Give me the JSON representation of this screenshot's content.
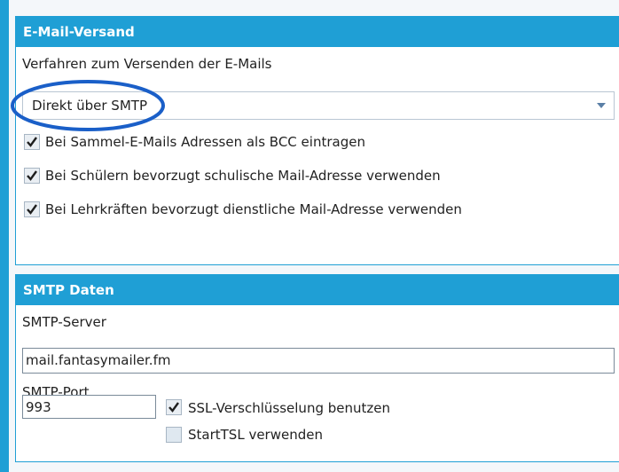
{
  "email_panel": {
    "title": "E-Mail-Versand",
    "method_label": "Verfahren zum Versenden der E-Mails",
    "method_select_value": "Direkt über SMTP",
    "options": [
      {
        "label": "Bei Sammel-E-Mails Adressen als BCC eintragen",
        "checked": true
      },
      {
        "label": "Bei Schülern bevorzugt schulische Mail-Adresse verwenden",
        "checked": true
      },
      {
        "label": "Bei Lehrkräften bevorzugt dienstliche Mail-Adresse verwenden",
        "checked": true
      }
    ]
  },
  "smtp_panel": {
    "title": "SMTP Daten",
    "server_label": "SMTP-Server",
    "server_value": "mail.fantasymailer.fm",
    "port_label": "SMTP-Port",
    "port_value": "993",
    "ssl_label": "SSL-Verschlüsselung benutzen",
    "ssl_checked": true,
    "starttls_label": "StartTSL verwenden",
    "starttls_checked": false
  },
  "colors": {
    "accent": "#1f9fd5",
    "highlight_ellipse": "#1a5fc8"
  },
  "icons": {
    "dropdown": "chevron-down-icon",
    "checkbox": "checkmark-icon"
  }
}
